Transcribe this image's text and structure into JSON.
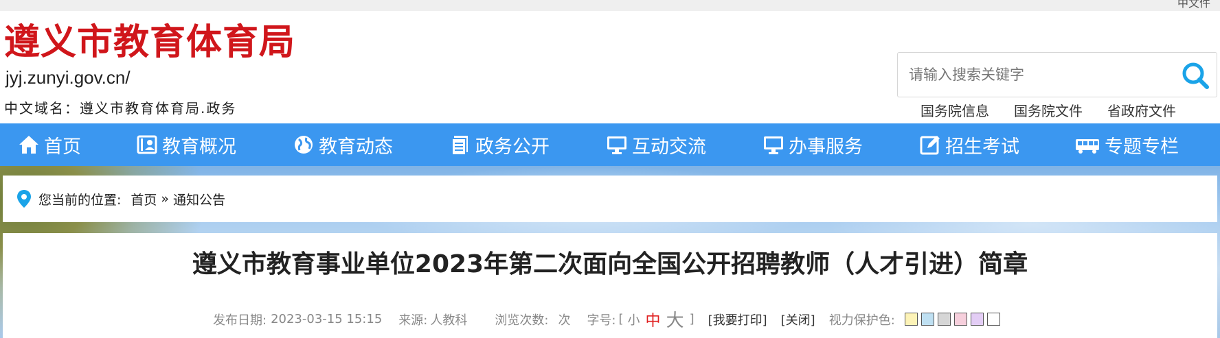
{
  "topbar": {
    "cut_text": "中文件"
  },
  "header": {
    "logo_title": "遵义市教育体育局",
    "logo_url": "jyj.zunyi.gov.cn/",
    "logo_domain": "中文域名：遵义市教育体育局.政务"
  },
  "search": {
    "placeholder": "请输入搜索关键字",
    "icon": "search-icon"
  },
  "quick_links": [
    "国务院信息",
    "国务院文件",
    "省政府文件"
  ],
  "nav": {
    "items": [
      {
        "label": "首页",
        "icon": "home-icon"
      },
      {
        "label": "教育概况",
        "icon": "profile-card-icon"
      },
      {
        "label": "教育动态",
        "icon": "globe-icon"
      },
      {
        "label": "政务公开",
        "icon": "document-icon"
      },
      {
        "label": "互动交流",
        "icon": "monitor-icon"
      },
      {
        "label": "办事服务",
        "icon": "monitor-icon"
      },
      {
        "label": "招生考试",
        "icon": "edit-icon"
      },
      {
        "label": "专题专栏",
        "icon": "bus-icon"
      }
    ],
    "bg_color": "#3b97f0"
  },
  "breadcrumb": {
    "label": "您当前的位置:",
    "items": [
      "首页",
      "通知公告"
    ],
    "separator": "»"
  },
  "article": {
    "title": "遵义市教育事业单位2023年第二次面向全国公开招聘教师（人才引进）简章",
    "meta": {
      "date_label": "发布日期:",
      "date_value": "2023-03-15 15:15",
      "source_label": "来源:",
      "source_value": "人教科",
      "views_label": "浏览次数:",
      "views_unit": "次",
      "font_label": "字号:",
      "font_open": "[",
      "font_small": "小",
      "font_mid": "中",
      "font_big": "大",
      "font_close": "]",
      "print_label": "[我要打印]",
      "close_label": "[关闭]",
      "eye_label": "视力保护色:",
      "swatches": [
        "#fdf3b7",
        "#bfe0f2",
        "#d6d6d6",
        "#f6cfdc",
        "#e3cdf5",
        "#ffffff"
      ]
    }
  }
}
